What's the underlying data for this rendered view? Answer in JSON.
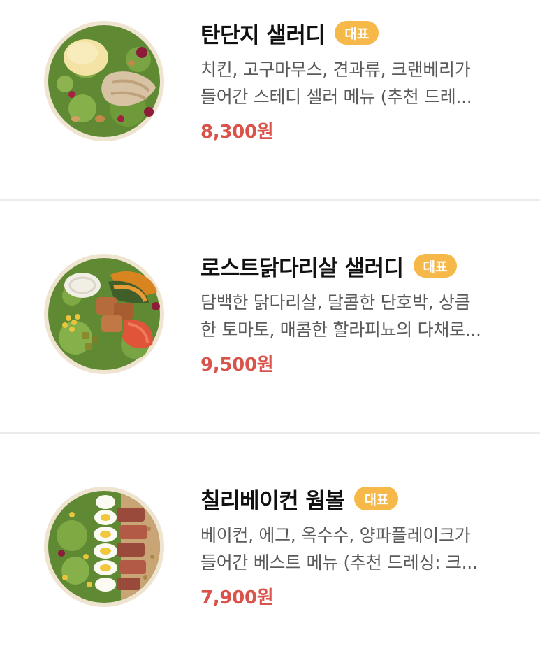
{
  "colors": {
    "badge": "#f7b84a",
    "price": "#d9534a",
    "title": "#111111",
    "description": "#5a5a5a",
    "divider": "#ebebeb"
  },
  "items": [
    {
      "name": "탄단지 샐러디",
      "badge": "대표",
      "description_lines": [
        "치킨, 고구마무스, 견과류, 크랜베리가",
        "들어간 스테디 셀러 메뉴 (추천 드레..."
      ],
      "price": "8,300원",
      "image": "salad-bowl-chicken-sweet-potato"
    },
    {
      "name": "로스트닭다리살 샐러디",
      "badge": "대표",
      "description_lines": [
        "담백한 닭다리살, 달콤한 단호박, 상큼",
        "한 토마토, 매콤한 할라피뇨의 다채로..."
      ],
      "price": "9,500원",
      "image": "salad-bowl-roast-chicken-thigh"
    },
    {
      "name": "칠리베이컨 웜볼",
      "badge": "대표",
      "description_lines": [
        "베이컨, 에그, 옥수수, 양파플레이크가",
        "들어간 베스트 메뉴 (추천 드레싱: 크..."
      ],
      "price": "7,900원",
      "image": "warm-bowl-bacon-egg"
    }
  ]
}
